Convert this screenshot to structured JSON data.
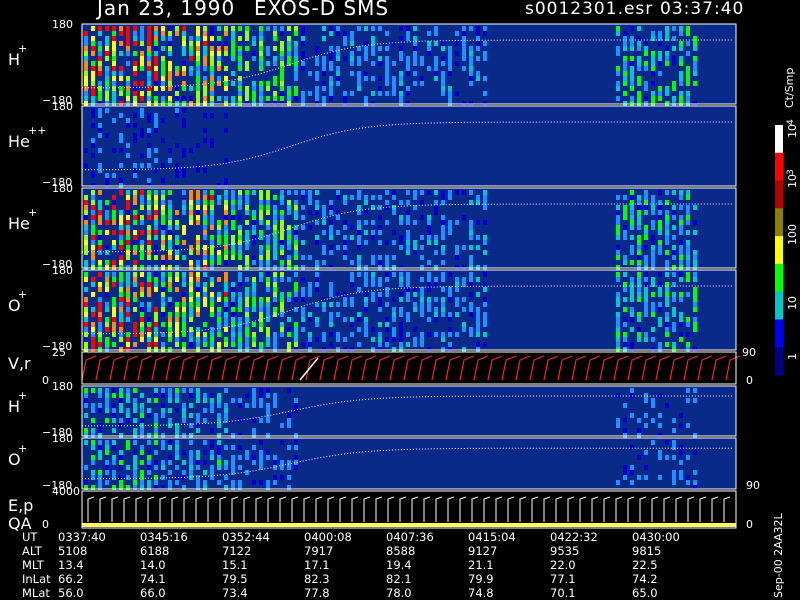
{
  "header": {
    "date": "Jan 23, 1990",
    "instrument": "EXOS-D SMS",
    "file": "s0012301.esr",
    "time": "03:37:40"
  },
  "panels": [
    {
      "label": "H",
      "sup": "+",
      "ymax": "180",
      "ymin": "−180"
    },
    {
      "label": "He",
      "sup": "++",
      "ymax": "180",
      "ymin": "−180"
    },
    {
      "label": "He",
      "sup": "+",
      "ymax": "180",
      "ymin": "−180"
    },
    {
      "label": "O",
      "sup": "+",
      "ymax": "180",
      "ymin": "−180"
    },
    {
      "label": "V,r",
      "sup": "",
      "ymax": "25",
      "ymin": "0",
      "right_top": "90",
      "right_bottom": "0"
    },
    {
      "label": "H",
      "sup": "+",
      "ymax": "180",
      "ymin": "−180"
    },
    {
      "label": "O",
      "sup": "+",
      "ymax": "180",
      "ymin": "−180",
      "right_bottom": "90"
    },
    {
      "label": "E,p",
      "label2": "QA",
      "ymax": "4000",
      "ymin": "0",
      "right_bottom": "0"
    }
  ],
  "colorbar": {
    "unit": "Ct/Smp",
    "ticks": [
      "10",
      "4",
      "10",
      "3",
      "100",
      "10",
      "1"
    ],
    "colors": [
      "#ffffff",
      "#ff0000",
      "#b00000",
      "#8b8000",
      "#ffff00",
      "#00ff00",
      "#00c8c8",
      "#0000ff",
      "#00008b"
    ]
  },
  "side_note": "Sep-00 2AA32L",
  "table": {
    "labels": [
      "UT",
      "ALT",
      "MLT",
      "InLat",
      "MLat"
    ],
    "columns": [
      [
        "0337:40",
        "5108",
        "13.4",
        "66.2",
        "56.0"
      ],
      [
        "0345:16",
        "6188",
        "14.0",
        "74.1",
        "66.0"
      ],
      [
        "0352:44",
        "7122",
        "15.1",
        "79.5",
        "73.4"
      ],
      [
        "0400:08",
        "7917",
        "17.1",
        "82.3",
        "77.8"
      ],
      [
        "0407:36",
        "8588",
        "19.4",
        "82.1",
        "78.0"
      ],
      [
        "0415:04",
        "9127",
        "21.1",
        "79.9",
        "74.8"
      ],
      [
        "0422:32",
        "9535",
        "22.0",
        "77.1",
        "70.1"
      ],
      [
        "0430:00",
        "9815",
        "22.5",
        "74.2",
        "65.0"
      ]
    ]
  },
  "chart_data": {
    "type": "heatmap",
    "title": "Jan 23, 1990   EXOS-D SMS",
    "x": [
      "0337:40",
      "0345:16",
      "0352:44",
      "0400:08",
      "0407:36",
      "0415:04",
      "0422:32",
      "0430:00"
    ],
    "series": [
      {
        "name": "H+",
        "yrange": [
          -180,
          180
        ]
      },
      {
        "name": "He++",
        "yrange": [
          -180,
          180
        ]
      },
      {
        "name": "He+",
        "yrange": [
          -180,
          180
        ]
      },
      {
        "name": "O+",
        "yrange": [
          -180,
          180
        ]
      },
      {
        "name": "V,r",
        "yrange": [
          0,
          25
        ]
      },
      {
        "name": "H+",
        "yrange": [
          -180,
          180
        ]
      },
      {
        "name": "O+",
        "yrange": [
          -180,
          180
        ]
      },
      {
        "name": "E,p",
        "yrange": [
          0,
          4000
        ]
      }
    ],
    "colorscale": {
      "unit": "Ct/Smp",
      "range": [
        1,
        10000
      ],
      "log": true
    }
  }
}
